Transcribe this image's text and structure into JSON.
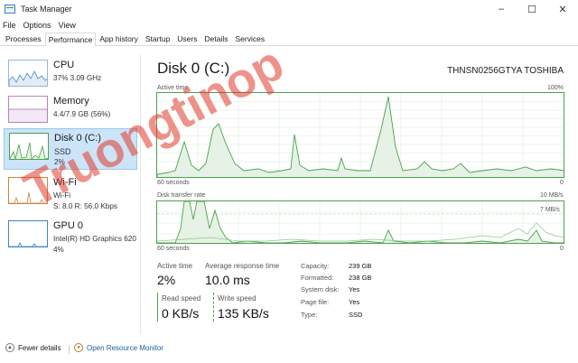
{
  "window": {
    "title": "Task Manager",
    "controls": [
      "–",
      "☐",
      "✕"
    ]
  },
  "menu": [
    "File",
    "Options",
    "View"
  ],
  "tabs": [
    "Processes",
    "Performance",
    "App history",
    "Startup",
    "Users",
    "Details",
    "Services"
  ],
  "sidebar": {
    "items": [
      {
        "name": "CPU",
        "line1": "37% 3.09 GHz",
        "line2": ""
      },
      {
        "name": "Memory",
        "line1": "4.4/7.9 GB (56%)",
        "line2": ""
      },
      {
        "name": "Disk 0 (C:)",
        "line1": "SSD",
        "line2": "2%"
      },
      {
        "name": "Wi-Fi",
        "line1": "Wi-Fi",
        "line2": "S: 8.0  R: 56.0 Kbps"
      },
      {
        "name": "GPU 0",
        "line1": "Intel(R) HD Graphics 620",
        "line2": "4%"
      }
    ]
  },
  "main": {
    "title": "Disk 0 (C:)",
    "device": "THNSN0256GTYA TOSHIBA",
    "graph1": {
      "top_left": "Active time",
      "top_right": "100%",
      "bottom_left": "60 seconds",
      "bottom_right": "0"
    },
    "graph2": {
      "top_left": "Disk transfer rate",
      "top_right": "10 MB/s",
      "mid_right": "7 MB/s",
      "bottom_left": "60 seconds",
      "bottom_right": "0"
    }
  },
  "stats": {
    "active_time": {
      "label": "Active time",
      "value": "2%"
    },
    "avg_response": {
      "label": "Average response time",
      "value": "10.0 ms"
    },
    "read_speed": {
      "label": "Read speed",
      "value": "0 KB/s"
    },
    "write_speed": {
      "label": "Write speed",
      "value": "135 KB/s"
    }
  },
  "properties": [
    {
      "label": "Capacity:",
      "value": "239 GB"
    },
    {
      "label": "Formatted:",
      "value": "238 GB"
    },
    {
      "label": "System disk:",
      "value": "Yes"
    },
    {
      "label": "Page file:",
      "value": "Yes"
    },
    {
      "label": "Type:",
      "value": "SSD"
    }
  ],
  "footer": {
    "fewer_details": "Fewer details",
    "open_monitor": "Open Resource Monitor"
  },
  "watermark": "Truongtinop",
  "colors": {
    "disk_green": "#4da14d",
    "selected_bg": "#cce4f7",
    "link": "#1e5ea8"
  }
}
